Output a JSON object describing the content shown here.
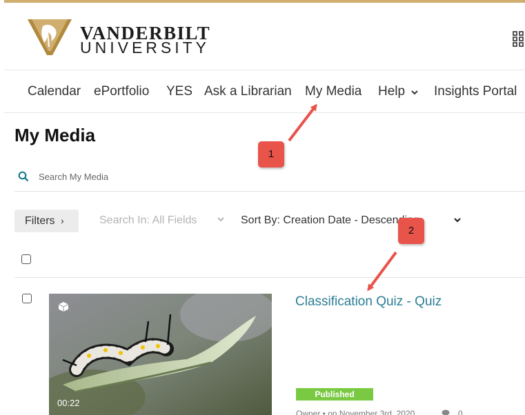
{
  "header": {
    "brand_line1": "VANDERBILT",
    "brand_line2": "UNIVERSITY",
    "logo_icon": "vanderbilt-oak-leaf-v-logo",
    "apps_icon": "grid-icon",
    "gold_color": "#cfae70"
  },
  "nav": {
    "items": [
      {
        "label": "Calendar"
      },
      {
        "label": "ePortfolio"
      },
      {
        "label": "YES"
      },
      {
        "label": "Ask a Librarian"
      },
      {
        "label": "My Media"
      },
      {
        "label": "Help"
      },
      {
        "label": "Insights Portal"
      }
    ]
  },
  "page": {
    "title": "My Media",
    "search_placeholder": "Search My Media"
  },
  "toolbar": {
    "filters_label": "Filters",
    "search_in_label": "Search In: All Fields",
    "sort_by_label": "Sort By: Creation Date - Descending"
  },
  "entries": [
    {
      "title": "Classification Quiz - Quiz",
      "duration": "00:22",
      "status": "Published",
      "meta": "Owner  •  on November 3rd, 2020",
      "comments": "0"
    }
  ],
  "annotations": [
    {
      "label": "1"
    },
    {
      "label": "2"
    }
  ],
  "colors": {
    "link": "#2a7d94",
    "published": "#7ac943",
    "callout": "#e8534a"
  }
}
